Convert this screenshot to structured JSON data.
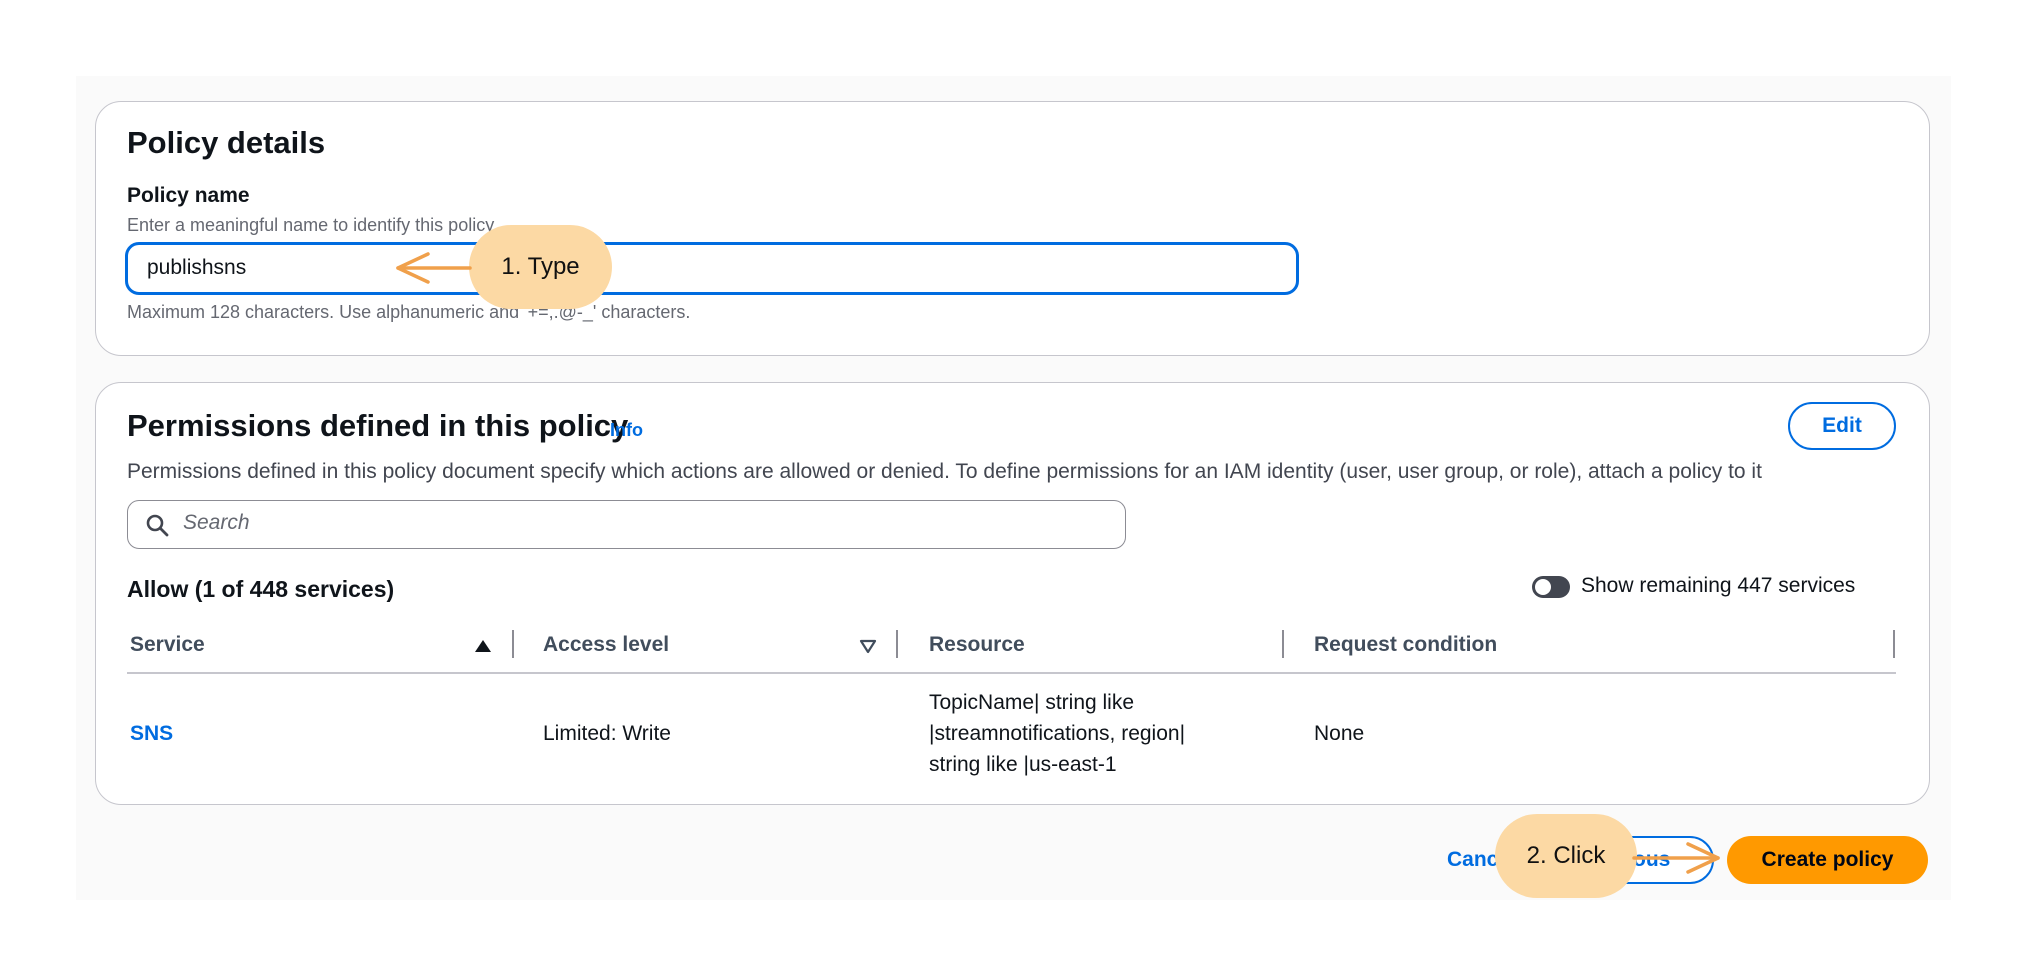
{
  "policy_details": {
    "title": "Policy details",
    "name_label": "Policy name",
    "name_description": "Enter a meaningful name to identify this policy.",
    "name_value": "publishsns",
    "name_constraint": "Maximum 128 characters. Use alphanumeric and '+=,.@-_' characters."
  },
  "permissions": {
    "title": "Permissions defined in this policy",
    "info_link": "Info",
    "edit_button": "Edit",
    "description": "Permissions defined in this policy document specify which actions are allowed or denied. To define permissions for an IAM identity (user, user group, or role), attach a policy to it",
    "search_placeholder": "Search",
    "allow_heading": "Allow (1 of 448 services)",
    "toggle_label": "Show remaining 447 services",
    "columns": [
      "Service",
      "Access level",
      "Resource",
      "Request condition"
    ],
    "rows": [
      {
        "service": "SNS",
        "access_level": "Limited: Write",
        "resource_lines": [
          "TopicName| string like",
          "|streamnotifications, region|",
          "string like |us-east-1"
        ],
        "request_condition": "None"
      }
    ]
  },
  "footer": {
    "cancel_label": "Cancel",
    "previous_label": "Previous",
    "create_label": "Create policy"
  },
  "annotations": {
    "step1": "1. Type",
    "step2": "2. Click"
  },
  "colors": {
    "accent": "#006ce0",
    "primary_button": "#ff9900",
    "annotation_bubble": "#fcd9a4",
    "annotation_arrow": "#f0a04b"
  },
  "icons": {
    "search": "search-icon",
    "sort_asc": "sort-ascending-icon",
    "sort_desc": "sort-descending-icon"
  }
}
